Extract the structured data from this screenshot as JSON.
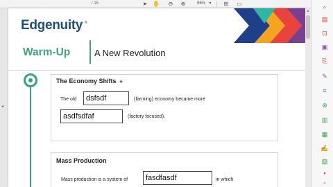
{
  "toolbar": {
    "page_indicator": "/ 15",
    "zoom": "96%",
    "icons": [
      "select-arrow-icon",
      "hand-icon",
      "zoom-out-icon",
      "zoom-in-icon",
      "fit-page-icon",
      "page-view-icon"
    ]
  },
  "page": {
    "logo_text": "Edgenuity",
    "logo_tm": "®",
    "header_title": "Warm-Up",
    "header_subtitle": "A New Revolution",
    "colors": {
      "accent": "#43a184",
      "logo": "#1d4f7a"
    },
    "sections": [
      {
        "title": "The Economy Shifts",
        "before_text": "The old",
        "field1_value": "dsfsdf",
        "hint1": "(farming) economy became more",
        "field2_value": "asdfsdfaf",
        "hint2": "(factory focused)."
      },
      {
        "title": "Mass Production",
        "sentence_start": "Mass production is a system of",
        "field_value": "fasdfasdf",
        "sentence_end": "in which"
      }
    ]
  },
  "right_panel": {
    "tools": [
      "search-icon",
      "export-pdf-icon",
      "create-pdf-icon",
      "edit-pdf-icon",
      "comment-icon",
      "combine-files-icon",
      "organize-pages-icon",
      "redact-icon",
      "protect-icon",
      "compress-icon",
      "fill-sign-icon",
      "send-review-icon",
      "stamp-icon",
      "measure-icon",
      "more-tools-icon"
    ]
  }
}
